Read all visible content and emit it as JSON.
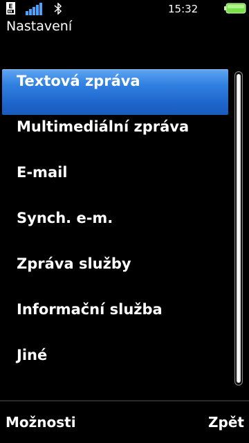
{
  "status_bar": {
    "network_badge": "E",
    "time": "15:32",
    "icons": [
      "network-e-icon",
      "signal-strength-icon",
      "bluetooth-icon",
      "battery-icon"
    ],
    "battery_color": "#7be34a"
  },
  "header": {
    "title": "Nastavení"
  },
  "menu": {
    "selected_index": 0,
    "accent_color": "#2f7fe0",
    "items": [
      {
        "label": "Textová zpráva"
      },
      {
        "label": "Multimediální zpráva"
      },
      {
        "label": "E-mail"
      },
      {
        "label": "Synch. e-m."
      },
      {
        "label": "Zpráva služby"
      },
      {
        "label": "Informační služba"
      },
      {
        "label": "Jiné"
      }
    ]
  },
  "softkeys": {
    "left": "Možnosti",
    "right": "Zpět"
  }
}
